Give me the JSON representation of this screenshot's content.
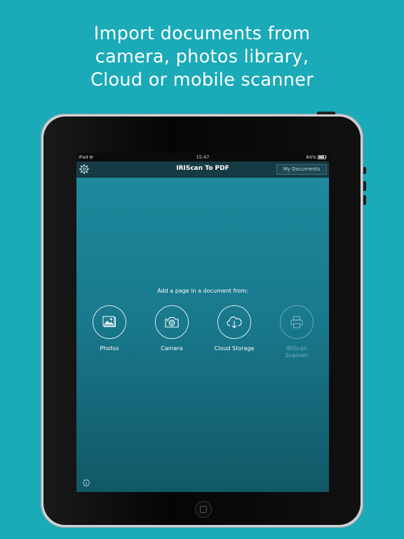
{
  "headline": {
    "line1": "Import documents from",
    "line2": "camera, photos library,",
    "line3": "Cloud or mobile scanner"
  },
  "status_bar": {
    "carrier": "iPad",
    "time": "15:47",
    "battery": "84%"
  },
  "navbar": {
    "title": "IRIScan To PDF",
    "my_documents": "My Documents",
    "settings_icon": "gear-icon"
  },
  "main": {
    "prompt": "Add a page in a document from:",
    "options": [
      {
        "label": "Photos",
        "icon": "photos-icon",
        "enabled": true
      },
      {
        "label": "Camera",
        "icon": "camera-icon",
        "enabled": true
      },
      {
        "label": "Cloud Storage",
        "icon": "cloud-download-icon",
        "enabled": true
      },
      {
        "label": "IRIScan Scanner",
        "icon": "printer-icon",
        "enabled": false
      }
    ],
    "info_icon": "info-icon"
  },
  "colors": {
    "background": "#1aaab8",
    "navbar": "#163b44",
    "screen_top": "#1e8da0",
    "screen_bottom": "#115866"
  }
}
